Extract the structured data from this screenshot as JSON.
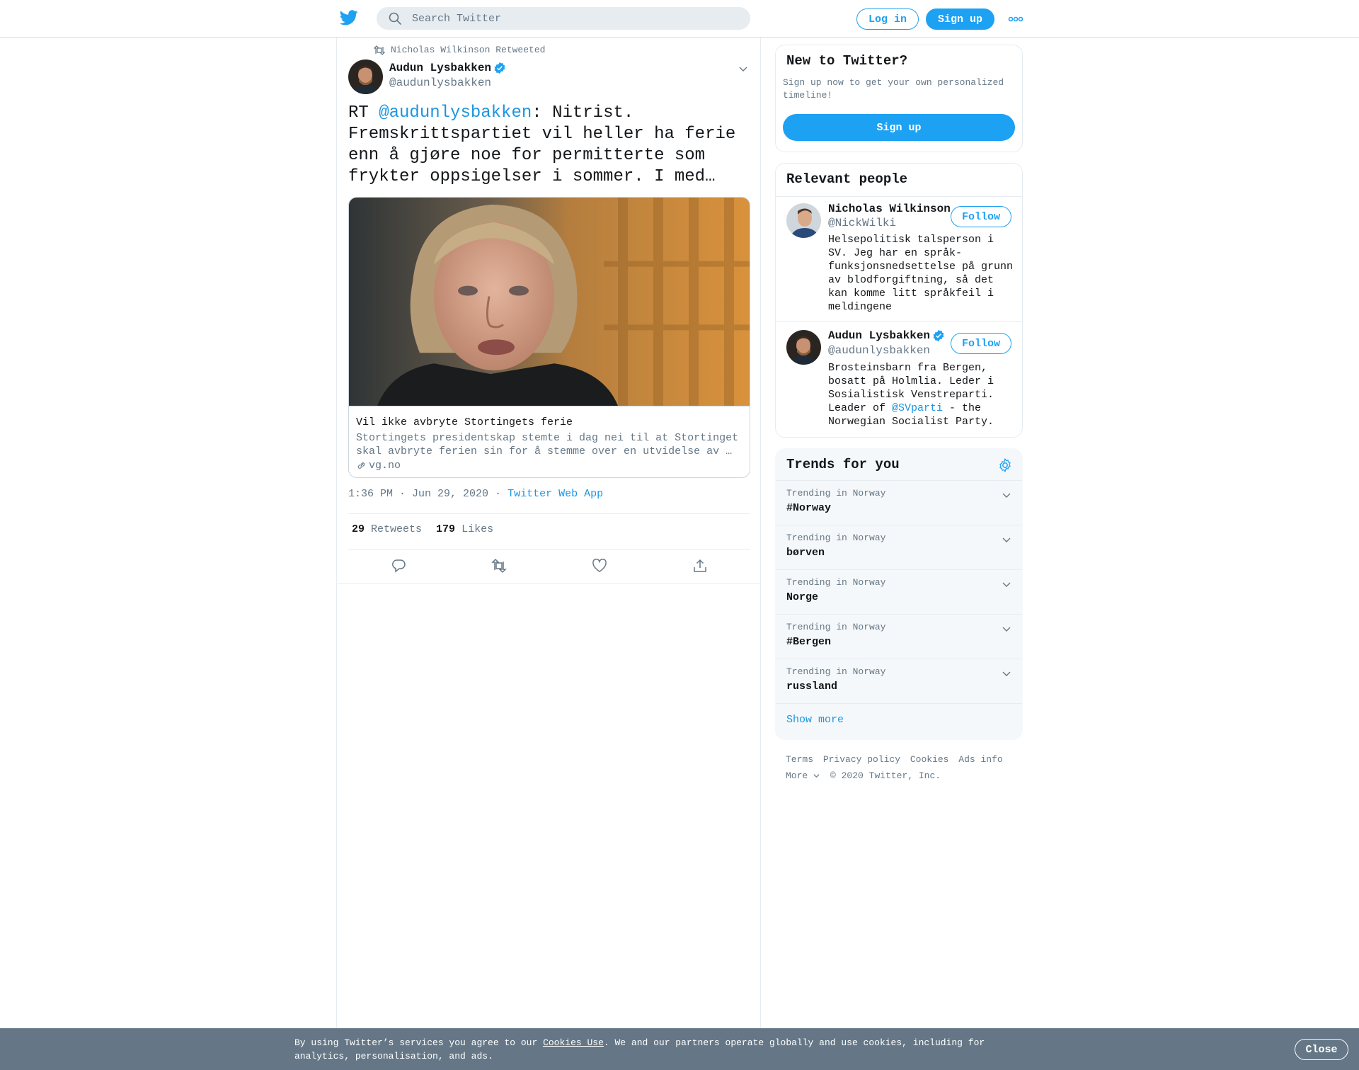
{
  "header": {
    "search_placeholder": "Search Twitter",
    "login_label": "Log in",
    "signup_label": "Sign up"
  },
  "tweet": {
    "retweeted_by": "Nicholas Wilkinson Retweeted",
    "author_name": "Audun Lysbakken",
    "author_handle": "@audunlysbakken",
    "text_prefix": "RT ",
    "text_mention": "@audunlysbakken",
    "text_body": ": Nitrist. Fremskrittspartiet vil heller ha ferie enn å gjøre noe for permitterte som frykter oppsigelser i sommer. I med…",
    "card": {
      "title": "Vil ikke avbryte Stortingets ferie",
      "description": "Stortingets presidentskap stemte i dag nei til at Stortinget skal avbryte ferien sin for å stemme over en utvidelse av …",
      "domain": "vg.no"
    },
    "timestamp": "1:36 PM · Jun 29, 2020",
    "separator": "·",
    "source": "Twitter Web App",
    "retweets_count": "29",
    "retweets_label": "Retweets",
    "likes_count": "179",
    "likes_label": "Likes"
  },
  "sidebar": {
    "new": {
      "title": "New to Twitter?",
      "text": "Sign up now to get your own personalized timeline!",
      "button": "Sign up"
    },
    "people": {
      "title": "Relevant people",
      "list": [
        {
          "name": "Nicholas Wilkinson",
          "handle": "@NickWilki",
          "bio": "Helsepolitisk talsperson i SV. Jeg har en språk-funksjonsnedsettelse på grunn av blodforgiftning, så det kan komme litt språkfeil i meldingene",
          "follow": "Follow"
        },
        {
          "name": "Audun Lysbakken",
          "handle": "@audunlysbakken",
          "bio_before": "Brosteinsbarn fra Bergen, bosatt på Holmlia. Leder i Sosialistisk Venstreparti. Leader of ",
          "bio_link": "@SVparti",
          "bio_after": " - the Norwegian Socialist Party.",
          "follow": "Follow"
        }
      ]
    },
    "trends": {
      "title": "Trends for you",
      "items": [
        {
          "context": "Trending in Norway",
          "name": "#Norway"
        },
        {
          "context": "Trending in Norway",
          "name": "børven"
        },
        {
          "context": "Trending in Norway",
          "name": "Norge"
        },
        {
          "context": "Trending in Norway",
          "name": "#Bergen"
        },
        {
          "context": "Trending in Norway",
          "name": "russland"
        }
      ],
      "show_more": "Show more"
    },
    "footer": {
      "terms": "Terms",
      "privacy": "Privacy policy",
      "cookies": "Cookies",
      "ads": "Ads info",
      "more": "More",
      "copyright": "© 2020 Twitter, Inc."
    }
  },
  "cookie_bar": {
    "text_before": "By using Twitter’s services you agree to our ",
    "link": "Cookies Use",
    "text_after": ". We and our partners operate globally and use cookies, including for analytics, personalisation, and ads.",
    "close": "Close"
  },
  "colors": {
    "brand": "#1da1f2",
    "link": "#1b95e0",
    "muted": "#657786",
    "cookie_bg": "#657786"
  }
}
